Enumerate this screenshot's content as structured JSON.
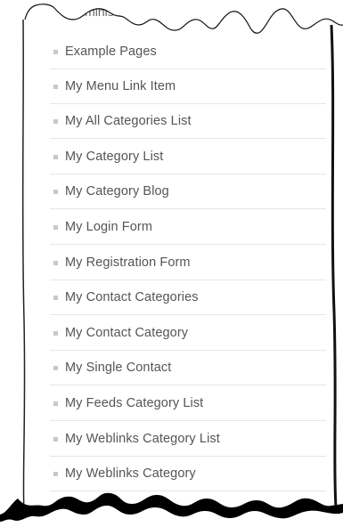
{
  "menu": {
    "top_cut_label": "Administrat",
    "items": [
      {
        "label": "Example Pages"
      },
      {
        "label": "My Menu Link Item"
      },
      {
        "label": "My All Categories List"
      },
      {
        "label": "My Category List"
      },
      {
        "label": "My Category Blog"
      },
      {
        "label": "My Login Form"
      },
      {
        "label": "My Registration Form"
      },
      {
        "label": "My Contact Categories"
      },
      {
        "label": "My Contact Category"
      },
      {
        "label": "My Single Contact"
      },
      {
        "label": "My Feeds Category List"
      },
      {
        "label": "My Weblinks Category List"
      },
      {
        "label": "My Weblinks Category"
      }
    ]
  },
  "colors": {
    "text": "#555555",
    "bullet": "#c8c8c8",
    "divider": "#e6e6e6",
    "edge": "#000000"
  },
  "icons": {
    "bullet": "square-bullet-icon"
  }
}
